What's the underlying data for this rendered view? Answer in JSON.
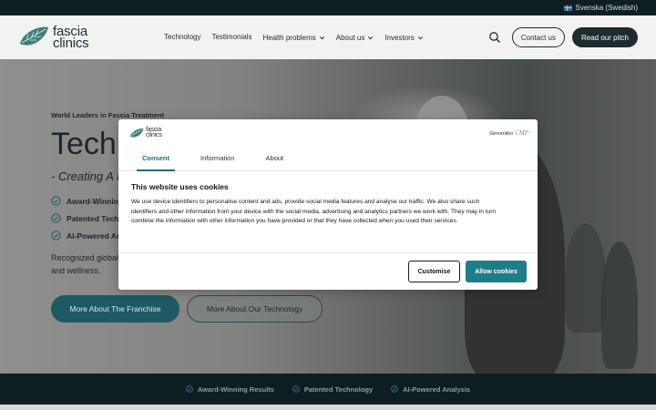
{
  "topbar": {
    "language": "Svenska (Swedish)"
  },
  "logo": {
    "line1": "fascia",
    "line2": "clinics"
  },
  "nav": {
    "items": [
      {
        "label": "Technology",
        "dropdown": false
      },
      {
        "label": "Testimonials",
        "dropdown": false
      },
      {
        "label": "Health problems",
        "dropdown": true
      },
      {
        "label": "About us",
        "dropdown": true
      },
      {
        "label": "Investors",
        "dropdown": true
      }
    ],
    "contact_label": "Contact us",
    "pitch_label": "Read our pitch"
  },
  "hero": {
    "eyebrow": "World Leaders in Fascia Treatment",
    "title": "Tech &",
    "subtitle": "- Creating A N",
    "bullets": [
      "Award-Winning",
      "Patented Techn",
      "AI-Powered An"
    ],
    "desc_line1": "Recognized global",
    "desc_line2": "and wellness.",
    "btn_franchise": "More About The Franchise",
    "btn_technology": "More About Our Technology"
  },
  "features": [
    "Award-Winning Results",
    "Patented Technology",
    "AI-Powered Analysis"
  ],
  "consent": {
    "logo_line1": "fascia",
    "logo_line2": "clinics",
    "brand": "Semantiko",
    "brand_suffix": "CMP",
    "tabs": [
      "Consent",
      "Information",
      "About"
    ],
    "active_tab": "Consent",
    "title": "This website uses cookies",
    "body_line1": "We use device identifiers to personalise content and ads, provide social media features and analyse our traffic. We also share such",
    "body_line2": "identifiers and other information from your device with the social media, advertising and analytics partners we work with. They may in turn",
    "body_line3": "combine the information with other information you have provided or that they have collected when you used their services.",
    "customise_label": "Customise",
    "allow_label": "Allow cookies"
  },
  "colors": {
    "accent": "#1f7d8a",
    "dark": "#0e1d21",
    "hero_button": "#1d5a63"
  }
}
